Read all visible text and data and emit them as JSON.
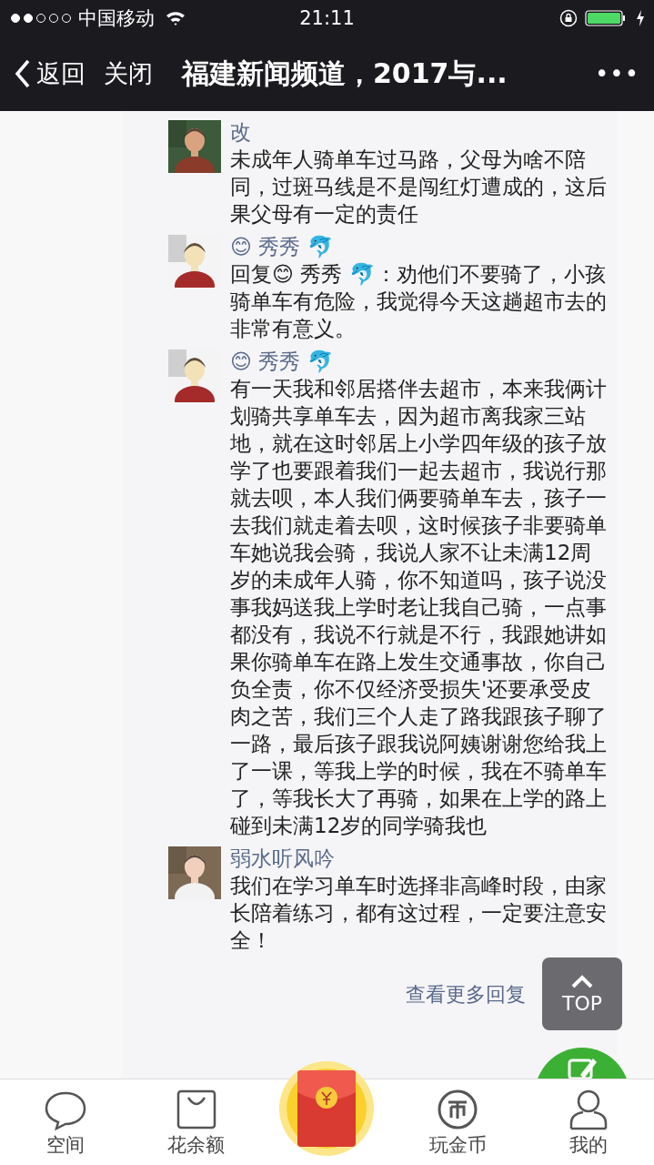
{
  "status_bar": {
    "carrier": "中国移动",
    "time": "21:11"
  },
  "nav": {
    "back": "返回",
    "close": "关闭",
    "title": "福建新闻频道，2017与...",
    "more": "•••"
  },
  "comments": [
    {
      "name": "改",
      "text": "未成年人骑单车过马路，父母为啥不陪同，过斑马线是不是闯红灯遭成的，这后果父母有一定的责任"
    },
    {
      "name": "😊 秀秀 🐬",
      "text": "回复😊 秀秀 🐬：劝他们不要骑了，小孩骑单车有危险，我觉得今天这趟超市去的非常有意义。"
    },
    {
      "name": "😊 秀秀 🐬",
      "text": "有一天我和邻居搭伴去超市，本来我俩计划骑共享单车去，因为超市离我家三站地，就在这时邻居上小学四年级的孩子放学了也要跟着我们一起去超市，我说行那就去呗，本人我们俩要骑单车去，孩子一去我们就走着去呗，这时候孩子非要骑单车她说我会骑，我说人家不让未满12周岁的未成年人骑，你不知道吗，孩子说没事我妈送我上学时老让我自己骑，一点事都没有，我说不行就是不行，我跟她讲如果你骑单车在路上发生交通事故，你自己负全责，你不仅经济受损失'还要承受皮肉之苦，我们三个人走了路我跟孩子聊了一路，最后孩子跟我说阿姨谢谢您给我上了一课，等我上学的时候，我在不骑单车了，等我长大了再骑，如果在上学的路上碰到未满12岁的同学骑我也"
    },
    {
      "name": "弱水听风吟",
      "text": "我们在学习单车时选择非高峰时段，由家长陪着练习，都有这过程，一定要注意安全！"
    }
  ],
  "more_replies": "查看更多回复",
  "top_button": {
    "label": "TOP"
  },
  "tabs": [
    {
      "kind": "tab",
      "label": "空间"
    },
    {
      "kind": "tab",
      "label": "花余额"
    },
    {
      "kind": "envelope"
    },
    {
      "kind": "tab",
      "label": "玩金币"
    },
    {
      "kind": "tab",
      "label": "我的"
    }
  ]
}
